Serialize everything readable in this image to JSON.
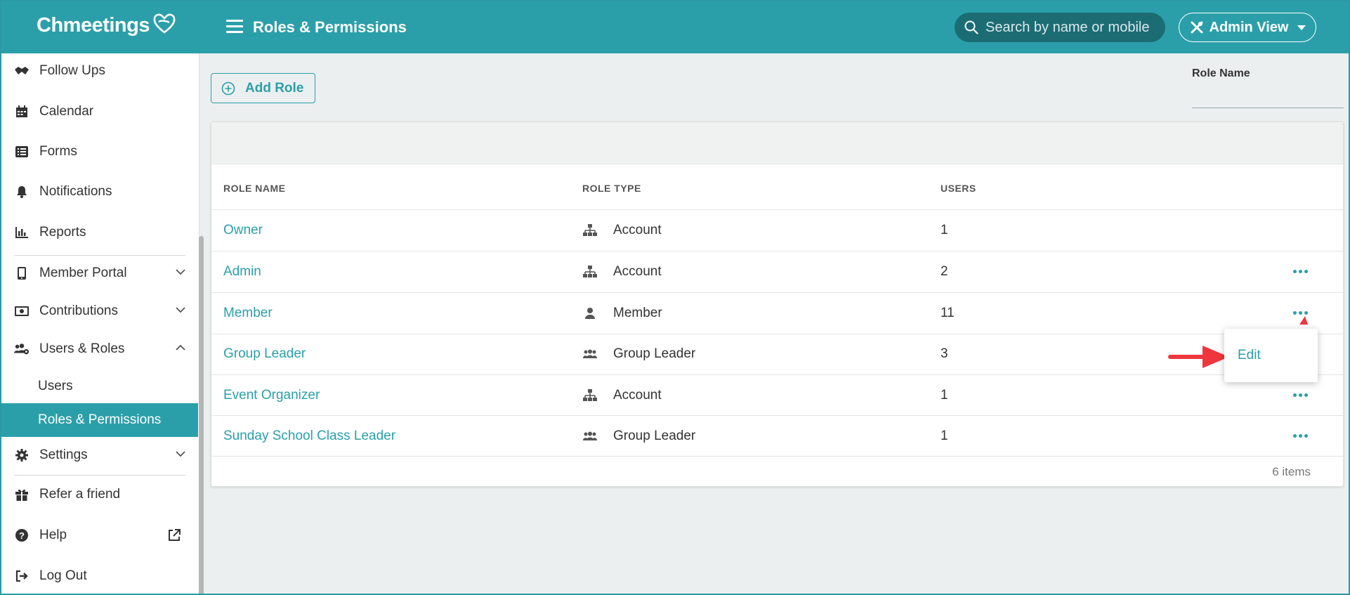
{
  "header": {
    "logo": "Chmeetings",
    "title": "Roles & Permissions",
    "search_placeholder": "Search by name or mobile",
    "view_label": "Admin View"
  },
  "sidebar": {
    "items": [
      {
        "label": "Follow Ups",
        "icon": "handshake-icon"
      },
      {
        "label": "Calendar",
        "icon": "calendar-icon"
      },
      {
        "label": "Forms",
        "icon": "list-icon"
      },
      {
        "label": "Notifications",
        "icon": "bell-icon"
      },
      {
        "label": "Reports",
        "icon": "chart-icon"
      },
      {
        "label": "Member Portal",
        "icon": "mobile-icon"
      },
      {
        "label": "Contributions",
        "icon": "money-icon"
      },
      {
        "label": "Users & Roles",
        "icon": "users-cog-icon"
      },
      {
        "label": "Users"
      },
      {
        "label": "Roles & Permissions"
      },
      {
        "label": "Settings",
        "icon": "gear-icon"
      },
      {
        "label": "Refer a friend",
        "icon": "gift-icon"
      },
      {
        "label": "Help",
        "icon": "question-icon"
      },
      {
        "label": "Log Out",
        "icon": "logout-icon"
      }
    ]
  },
  "main": {
    "add_role_label": "Add Role",
    "filter_label": "Role Name",
    "columns": [
      "ROLE NAME",
      "ROLE TYPE",
      "USERS"
    ],
    "rows": [
      {
        "name": "Owner",
        "type": "Account",
        "type_icon": "sitemap-icon",
        "users": "1"
      },
      {
        "name": "Admin",
        "type": "Account",
        "type_icon": "sitemap-icon",
        "users": "2"
      },
      {
        "name": "Member",
        "type": "Member",
        "type_icon": "user-icon",
        "users": "11"
      },
      {
        "name": "Group Leader",
        "type": "Group Leader",
        "type_icon": "users-icon",
        "users": "3"
      },
      {
        "name": "Event Organizer",
        "type": "Account",
        "type_icon": "sitemap-icon",
        "users": "1"
      },
      {
        "name": "Sunday School Class Leader",
        "type": "Group Leader",
        "type_icon": "users-icon",
        "users": "1"
      }
    ],
    "item_count": "6 items",
    "popup_edit_label": "Edit"
  },
  "colors": {
    "brand": "#2b9fa9",
    "search_bg": "#1c6c74",
    "annotation_arrow": "#f0363d"
  }
}
